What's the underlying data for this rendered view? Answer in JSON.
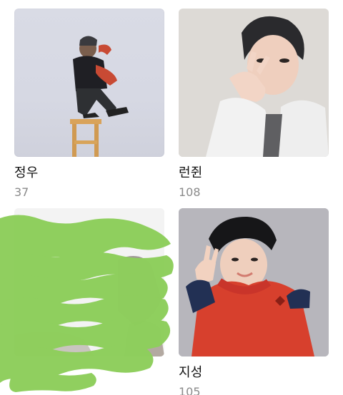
{
  "albums": [
    {
      "name": "정우",
      "count": "37"
    },
    {
      "name": "런쥔",
      "count": "108"
    },
    {
      "name": "",
      "count": ""
    },
    {
      "name": "지성",
      "count": "105"
    }
  ],
  "colors": {
    "name_text": "#111111",
    "count_text": "#8a8a8a",
    "censor_green": "#8ecf5c"
  },
  "icons": {
    "album_thumbnail": "photo-thumbnail"
  }
}
